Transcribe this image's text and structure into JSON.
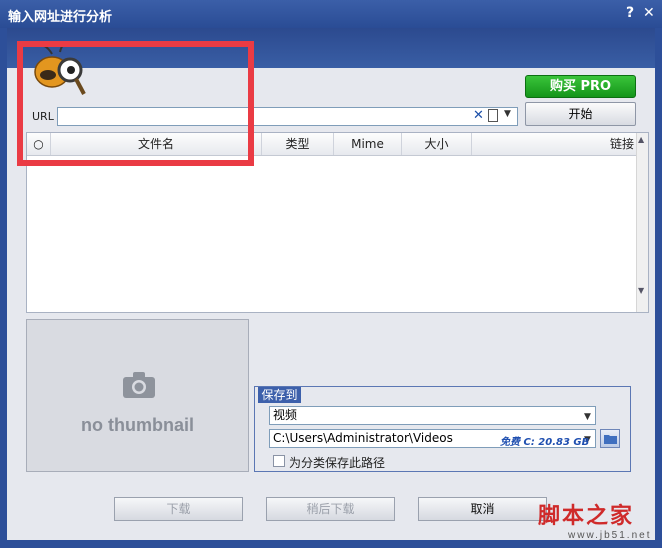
{
  "window": {
    "title": "输入网址进行分析",
    "help": "?",
    "close": "✕"
  },
  "colors": {
    "titlebar": "#2d4f99",
    "buy_button": "#1aa022",
    "highlight_box": "#ea3b44",
    "free_space_text": "#1f4fb0"
  },
  "toolbar": {
    "buy_label": "购买 PRO",
    "start_label": "开始"
  },
  "url": {
    "label": "URL",
    "value": "",
    "clear_icon": "clear-x-icon",
    "paste_icon": "clipboard-icon",
    "dropdown_icon": "chevron-down-icon"
  },
  "table": {
    "columns": [
      "○",
      "文件名",
      "类型",
      "Mime",
      "大小",
      "链接"
    ],
    "rows": []
  },
  "thumbnail": {
    "icon": "camera-icon",
    "text": "no thumbnail"
  },
  "save": {
    "legend": "保存到",
    "type_value": "视频",
    "path_value": "C:\\Users\\Administrator\\Videos",
    "free_space": "免费 C: 20.83 GB",
    "folder_icon": "folder-icon",
    "checkbox_label": "为分类保存此路径",
    "checkbox_checked": false
  },
  "footer": {
    "download_label": "下载",
    "later_label": "稍后下载",
    "cancel_label": "取消"
  },
  "watermark": {
    "main": "脚本之家",
    "sub": "www.jb51.net"
  }
}
